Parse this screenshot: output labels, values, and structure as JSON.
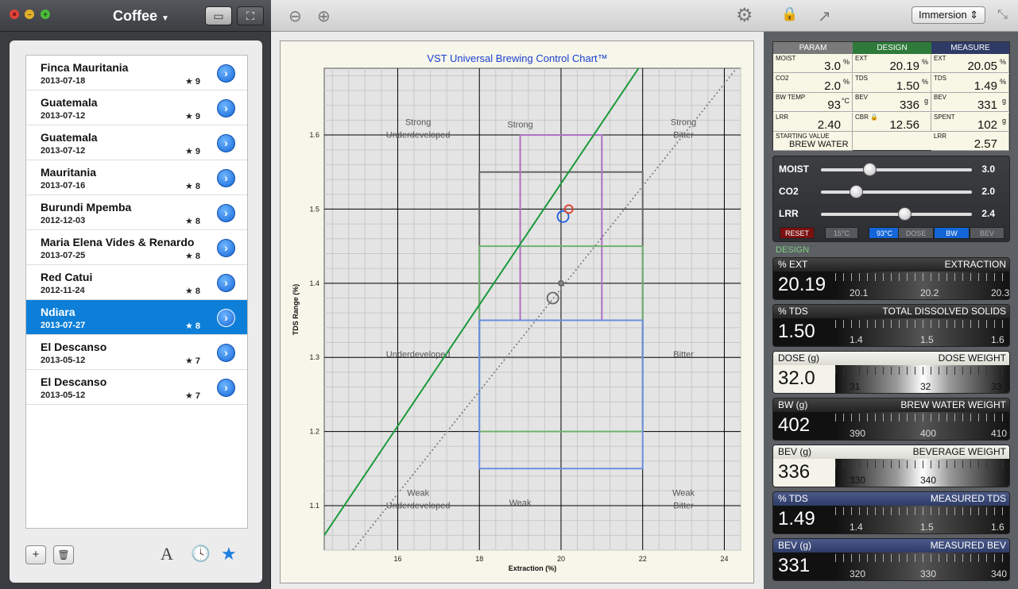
{
  "window": {
    "title": "Coffee"
  },
  "list": [
    {
      "name": "Finca Mauritania",
      "date": "2013-07-18",
      "rating": "★ 9"
    },
    {
      "name": "Guatemala",
      "date": "2013-07-12",
      "rating": "★ 9"
    },
    {
      "name": "Guatemala",
      "date": "2013-07-12",
      "rating": "★ 9"
    },
    {
      "name": "Mauritania",
      "date": "2013-07-16",
      "rating": "★ 8"
    },
    {
      "name": "Burundi Mpemba",
      "date": "2012-12-03",
      "rating": "★ 8"
    },
    {
      "name": "Maria Elena Vides & Renardo",
      "date": "2013-07-25",
      "rating": "★ 8"
    },
    {
      "name": "Red Catui",
      "date": "2012-11-24",
      "rating": "★ 8"
    },
    {
      "name": "Ndiara",
      "date": "2013-07-27",
      "rating": "★ 8",
      "selected": true
    },
    {
      "name": "El Descanso",
      "date": "2013-05-12",
      "rating": "★ 7"
    },
    {
      "name": "El Descanso",
      "date": "2013-05-12",
      "rating": "★ 7"
    }
  ],
  "footer": {
    "add": "+",
    "trash": "🗑",
    "font": "A",
    "clock": "🕓",
    "star": "★"
  },
  "toolbar": {
    "zoom_out": "⊖",
    "zoom_in": "⊕",
    "gear": "⚙",
    "lock": "🔒",
    "share": "↗",
    "mode": "Immersion ⇕",
    "shrink": "⤡"
  },
  "chart_data": {
    "type": "line",
    "title": "VST Universal Brewing Control Chart™",
    "xlabel": "Extraction (%)",
    "ylabel": "TDS Range (%)",
    "xlim": [
      14.2,
      24.4
    ],
    "ylim": [
      1.04,
      1.69
    ],
    "xticks": [
      16,
      18,
      20,
      22,
      24
    ],
    "yticks": [
      1.1,
      1.2,
      1.3,
      1.4,
      1.5,
      1.6
    ],
    "zones": [
      {
        "lines": [
          "Strong",
          "Underdeveloped"
        ],
        "x": 16.5,
        "y": 1.605
      },
      {
        "lines": [
          "Strong"
        ],
        "x": 19.0,
        "y": 1.61
      },
      {
        "lines": [
          "Strong",
          "Bitter"
        ],
        "x": 23.0,
        "y": 1.605
      },
      {
        "lines": [
          "Underdeveloped"
        ],
        "x": 16.5,
        "y": 1.3
      },
      {
        "lines": [
          "Bitter"
        ],
        "x": 23.0,
        "y": 1.3
      },
      {
        "lines": [
          "Weak",
          "Underdeveloped"
        ],
        "x": 16.5,
        "y": 1.105
      },
      {
        "lines": [
          "Weak"
        ],
        "x": 19.0,
        "y": 1.1
      },
      {
        "lines": [
          "Weak",
          "Bitter"
        ],
        "x": 23.0,
        "y": 1.105
      }
    ],
    "boxes": [
      {
        "x": [
          18,
          22
        ],
        "y": [
          1.3,
          1.55
        ],
        "color": "#666666"
      },
      {
        "x": [
          19,
          21
        ],
        "y": [
          1.35,
          1.6
        ],
        "color": "#b070c0"
      },
      {
        "x": [
          18,
          22
        ],
        "y": [
          1.2,
          1.45
        ],
        "color": "#70b070"
      },
      {
        "x": [
          18,
          22
        ],
        "y": [
          1.15,
          1.35
        ],
        "color": "#6a8ee0"
      }
    ],
    "series": [
      {
        "type": "line",
        "x": [
          14.2,
          21.9
        ],
        "y": [
          1.06,
          1.69
        ],
        "color": "#1a9a3a"
      },
      {
        "type": "line",
        "x": [
          14.9,
          24.3
        ],
        "y": [
          1.04,
          1.69
        ],
        "color": "#777777",
        "dashed": true
      }
    ],
    "points": [
      {
        "x": 20.05,
        "y": 1.49,
        "color": "#1a5fe0"
      },
      {
        "x": 20.19,
        "y": 1.5,
        "color": "#e03a2a"
      },
      {
        "x": 19.8,
        "y": 1.38,
        "color": "#666666"
      },
      {
        "x": 20.0,
        "y": 1.4,
        "color": "#666666"
      }
    ]
  },
  "params": {
    "headers": [
      "PARAM",
      "DESIGN",
      "MEASURE"
    ],
    "header_colors": [
      "#7a7a7a",
      "#2e7a3a",
      "#2e3b66"
    ],
    "cells": [
      [
        {
          "k": "MOIST",
          "v": "3.0",
          "u": "%"
        },
        {
          "k": "EXT",
          "v": "20.19",
          "u": "%"
        },
        {
          "k": "EXT",
          "v": "20.05",
          "u": "%"
        }
      ],
      [
        {
          "k": "CO2",
          "v": "2.0",
          "u": "%"
        },
        {
          "k": "TDS",
          "v": "1.50",
          "u": "%"
        },
        {
          "k": "TDS",
          "v": "1.49",
          "u": "%"
        }
      ],
      [
        {
          "k": "BW TEMP",
          "v": "93",
          "u": "°C"
        },
        {
          "k": "BEV",
          "v": "336",
          "u": "g"
        },
        {
          "k": "BEV",
          "v": "331",
          "u": "g"
        }
      ],
      [
        {
          "k": "LRR",
          "v": "2.40",
          "u": ""
        },
        {
          "k": "CBR 🔒",
          "v": "12.56",
          "u": ""
        },
        {
          "k": "SPENT",
          "v": "102",
          "u": "g"
        }
      ],
      [
        {
          "k": "STARTING VALUE",
          "v": "BREW WATER",
          "u": ""
        },
        {
          "k": "",
          "v": "",
          "u": ""
        },
        {
          "k": "LRR",
          "v": "2.57",
          "u": ""
        }
      ]
    ]
  },
  "sliders": [
    {
      "label": "MOIST",
      "value": "3.0",
      "level": 0.32
    },
    {
      "label": "CO2",
      "value": "2.0",
      "level": 0.23
    },
    {
      "label": "LRR",
      "value": "2.4",
      "level": 0.55
    }
  ],
  "slider_buttons": [
    "RESET",
    "15°C",
    "93°C",
    "DOSE",
    "BW",
    "BEV"
  ],
  "design_label": "DESIGN",
  "meters": [
    {
      "unit": "% EXT",
      "name": "EXTRACTION",
      "value": "20.19",
      "ticks": [
        "20.1",
        "20.2",
        "20.3"
      ],
      "style": "hdark"
    },
    {
      "unit": "% TDS",
      "name": "TOTAL DISSOLVED SOLIDS",
      "value": "1.50",
      "ticks": [
        "1.4",
        "1.5",
        "1.6"
      ],
      "style": "hdark"
    },
    {
      "unit": "DOSE (g)",
      "name": "DOSE WEIGHT",
      "value": "32.0",
      "ticks": [
        "31",
        "32",
        "33"
      ],
      "style": "light"
    },
    {
      "unit": "BW (g)",
      "name": "BREW WATER WEIGHT",
      "value": "402",
      "ticks": [
        "390",
        "400",
        "410"
      ],
      "style": "hdark"
    },
    {
      "unit": "BEV (g)",
      "name": "BEVERAGE WEIGHT",
      "value": "336",
      "ticks": [
        "330",
        "340",
        ""
      ],
      "style": "light"
    },
    {
      "unit": "% TDS",
      "name": "MEASURED TDS",
      "value": "1.49",
      "ticks": [
        "1.4",
        "1.5",
        "1.6"
      ],
      "style": "hblue"
    },
    {
      "unit": "BEV (g)",
      "name": "MEASURED BEV",
      "value": "331",
      "ticks": [
        "320",
        "330",
        "340"
      ],
      "style": "hblue"
    }
  ]
}
